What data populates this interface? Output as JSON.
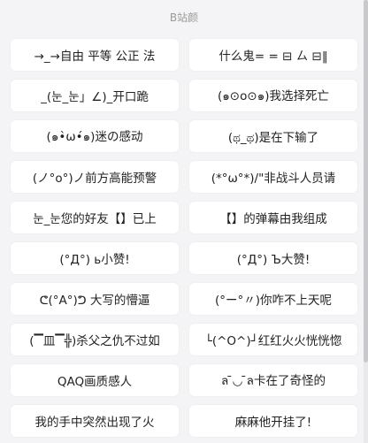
{
  "header": {
    "title": "B站颜"
  },
  "items": [
    "→_→自由 平等 公正 法",
    "什么鬼= = ⊟ ㄙ ⊟‖",
    "_(눈_눈」∠)_开口跪",
    "(๑⊙o⊙๑)我选择死亡",
    "(๑•̀ω•́๑)迷の感动",
    "(ಥ_ಥ)是在下输了",
    "(ノ°ο°)ノ前方高能预警",
    "(*°ω°*)/\"非战斗人员请",
    "눈_눈您的好友【】已上",
    "【】的弹幕由我组成",
    "(°Д°) ь小赞!",
    "(°Д°) Ъ大赞!",
    "ᕦ(°A°)ᕤ 大写的懵逼",
    "(°ー°〃)你咋不上天呢",
    "(▔皿▔╬)杀父之仇不过如",
    "└(^O^)┘红红火火恍恍惚",
    "QAQ画质感人",
    "ล ̄◡ ̄ล卡在了奇怪的",
    "我的手中突然出现了火",
    "麻麻他开挂了!"
  ]
}
